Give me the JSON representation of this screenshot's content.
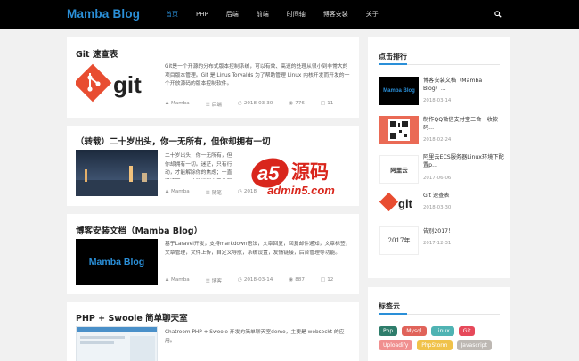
{
  "header": {
    "logo": "Mamba Blog",
    "nav": [
      "首页",
      "PHP",
      "后端",
      "前端",
      "时间轴",
      "博客安装",
      "关于"
    ]
  },
  "posts": [
    {
      "title": "Git 速查表",
      "thumb": "git",
      "desc": "Git是一个开源的分布式版本控制系统，可以有效、高速的处理从很小到非常大的项目版本管理。Git 是 Linus Torvalds 为了帮助管理 Linux 内核开发而开发的一个开放源码的版本控制软件。",
      "author": "Mamba",
      "category": "后端",
      "date": "2018-03-30",
      "views": "776",
      "comments": "11"
    },
    {
      "title": "（转载）二十岁出头，你一无所有，但你却拥有一切",
      "thumb": "photo",
      "desc": "二十岁出头，你一无所有，但你却拥有一切。迷茫，只有行动，才能解除你的焦虑；一直坚持下去，才能找到自己的驿站，读到自己的播盘里像《喜路两…》…",
      "author": "Mamba",
      "category": "随笔",
      "date": "2018"
    },
    {
      "title": "博客安装文档（Mamba Blog）",
      "thumb": "mamba",
      "thumb_label": "Mamba Blog",
      "desc": "基于Laravel开发，支持markdown语法，文章回复，回复邮件通知，文章标签，文章管理，文件上传，自定义导航，系统设置，友情链接，后台管理等功能。",
      "author": "Mamba",
      "category": "博客",
      "date": "2018-03-14",
      "views": "887",
      "comments": "12"
    },
    {
      "title": "PHP + Swoole 简单聊天室",
      "thumb": "chat",
      "desc": "Chatroom PHP + Swoole 开发的简单聊天室demo，主要是 websockt 的应用。"
    }
  ],
  "sidebar": {
    "rank_title": "点击排行",
    "rank": [
      {
        "title": "博客安装文档（Mamba Blog）...",
        "date": "2018-03-14",
        "thumb": "mamba",
        "thumb_label": "Mamba Blog"
      },
      {
        "title": "制作QQ微信支付宝三合一收款码...",
        "date": "2018-02-24",
        "thumb": "qr"
      },
      {
        "title": "阿里云ECS服务器Linux环境下配置p...",
        "date": "2017-06-06",
        "thumb": "aliyun",
        "thumb_label": "阿里云"
      },
      {
        "title": "Git 速查表",
        "date": "2018-03-30",
        "thumb": "git"
      },
      {
        "title": "告别2017！",
        "date": "2017-12-31",
        "thumb": "y2017",
        "thumb_label": "2017年"
      }
    ],
    "tags_title": "标签云",
    "tags": [
      {
        "label": "Php",
        "color": "#2e7d6b"
      },
      {
        "label": "Mysql",
        "color": "#e0635a"
      },
      {
        "label": "Linux",
        "color": "#4fb3b3"
      },
      {
        "label": "Git",
        "color": "#e6495a"
      },
      {
        "label": "Uploadify",
        "color": "#f08f8f"
      },
      {
        "label": "PhpStorm",
        "color": "#f0c24a"
      },
      {
        "label": "Javascript",
        "color": "#bdb8b3"
      }
    ]
  },
  "watermark": {
    "brand": "a5",
    "cn": "源码",
    "site": "admin5.com"
  }
}
